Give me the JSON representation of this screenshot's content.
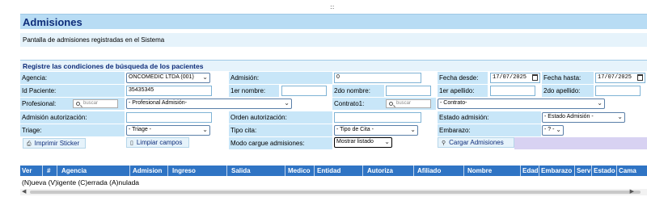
{
  "header": {
    "handle": "::",
    "title": "Admisiones",
    "subtitle": "Pantalla de admisiones registradas en el Sistema",
    "section_title": "Registre las condiciones de búsqueda de los pacientes"
  },
  "form": {
    "agencia_label": "Agencia:",
    "agencia_value": "ONCOMEDIC LTDA (001)",
    "admision_label": "Admisión:",
    "admision_value": "0",
    "fecha_desde_label": "Fecha desde:",
    "fecha_desde_value": "17/07/2025",
    "fecha_hasta_label": "Fecha hasta:",
    "fecha_hasta_value": "17/07/2025",
    "id_paciente_label": "Id Paciente:",
    "id_paciente_value": "35435345",
    "primer_nombre_label": "1er nombre:",
    "primer_nombre_value": "",
    "segundo_nombre_label": "2do nombre:",
    "segundo_nombre_value": "",
    "primer_apellido_label": "1er apellido:",
    "primer_apellido_value": "",
    "segundo_apellido_label": "2do apellido:",
    "segundo_apellido_value": "",
    "profesional_label": "Profesional:",
    "profesional_search_placeholder": "buscar",
    "profesional_value": "- Profesional Admisión-",
    "contrato_label": "Contrato1:",
    "contrato_search_placeholder": "buscar",
    "contrato_value": "- Contrato-",
    "admision_autorizacion_label": "Admisión autorización:",
    "admision_autorizacion_value": "",
    "orden_autorizacion_label": "Orden autorización:",
    "orden_autorizacion_value": "",
    "estado_admision_label": "Estado admisión:",
    "estado_admision_value": "- Estado Admisión -",
    "triage_label": "Triage:",
    "triage_value": "- Triage -",
    "tipo_cita_label": "Tipo cita:",
    "tipo_cita_value": "- Tipo de Cita -",
    "embarazo_label": "Embarazo:",
    "embarazo_value": "- ? -",
    "modo_cargue_label": "Modo cargue admisiones:",
    "modo_cargue_value": "Mostrar listado"
  },
  "buttons": {
    "imprimir_sticker": "Imprimir Sticker",
    "limpiar_campos": "Limpiar campos",
    "cargar_admisiones": "Cargar Admisiones"
  },
  "grid": {
    "columns": [
      "Ver",
      "#",
      "Agencia",
      "Admision",
      "Ingreso",
      "Salida",
      "Medico",
      "Entidad",
      "Autoriza",
      "Afiliado",
      "Nombre",
      "Edad",
      "Embarazo",
      "Serv",
      "Estado",
      "Cama"
    ],
    "legend": "(N)ueva (V)igente (C)errada (A)nulada"
  },
  "colors": {
    "title_text": "#0e2d7a",
    "label_cell": "#c8e6f8",
    "grid_header": "#2f74c4"
  }
}
